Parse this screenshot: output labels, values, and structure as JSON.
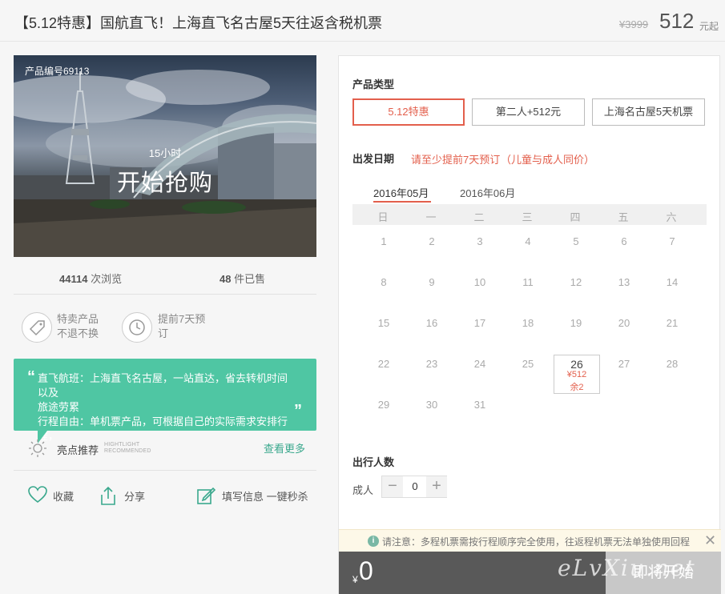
{
  "header": {
    "title": "【5.12特惠】国航直飞！上海直飞名古屋5天往返含税机票",
    "old_price": "¥3999",
    "price": "512",
    "price_suffix": "元起"
  },
  "hero": {
    "product_code": "产品编号69113",
    "countdown": "15小时",
    "action": "开始抢购"
  },
  "stats": {
    "views_num": "44114",
    "views_label": "次浏览",
    "sold_num": "48",
    "sold_label": "件已售"
  },
  "badges": [
    {
      "line1": "特卖产品",
      "line2": "不退不换",
      "icon": "tag-icon"
    },
    {
      "line1": "提前7天预",
      "line2": "订",
      "icon": "clock-icon"
    }
  ],
  "tip": {
    "line1": "直飞航班：上海直飞名古屋，一站直达，省去转机时间以及",
    "line2": "旅途劳累",
    "line3": "行程自由：单机票产品，可根据自己的实际需求安排行程，"
  },
  "highlight": {
    "label": "亮点推荐",
    "en_line1": "HIGHTLIGHT",
    "en_line2": "RECOMMENDED",
    "more": "查看更多"
  },
  "actions": {
    "favorite": "收藏",
    "share": "分享",
    "fill": "填写信息 一键秒杀"
  },
  "booking": {
    "product_type_label": "产品类型",
    "options": [
      "5.12特惠",
      "第二人+512元",
      "上海名古屋5天机票"
    ],
    "active_option": 0,
    "date_label": "出发日期",
    "date_note1": "请至少提前7天预订",
    "date_note2": "（儿童与成人同价）",
    "months": [
      "2016年05月",
      "2016年06月"
    ],
    "weekdays": [
      "日",
      "一",
      "二",
      "三",
      "四",
      "五",
      "六"
    ],
    "days": [
      [
        "1",
        "2",
        "3",
        "4",
        "5",
        "6",
        "7"
      ],
      [
        "8",
        "9",
        "10",
        "11",
        "12",
        "13",
        "14"
      ],
      [
        "15",
        "16",
        "17",
        "18",
        "19",
        "20",
        "21"
      ],
      [
        "22",
        "23",
        "24",
        "25",
        "26",
        "27",
        "28"
      ],
      [
        "29",
        "30",
        "31",
        "",
        "",
        "",
        ""
      ]
    ],
    "selected_day": "26",
    "selected_price": "¥512",
    "selected_remaining": "余2",
    "pax_label": "出行人数",
    "adult_label": "成人",
    "adult_count": "0",
    "minus": "−",
    "plus": "+",
    "notice": "请注意：多程机票需按行程顺序完全使用，往返程机票无法单独使用回程",
    "close": "✕",
    "currency": "¥",
    "total": "0",
    "book_button": "即将开始"
  },
  "watermark": "eLvXiu.net"
}
